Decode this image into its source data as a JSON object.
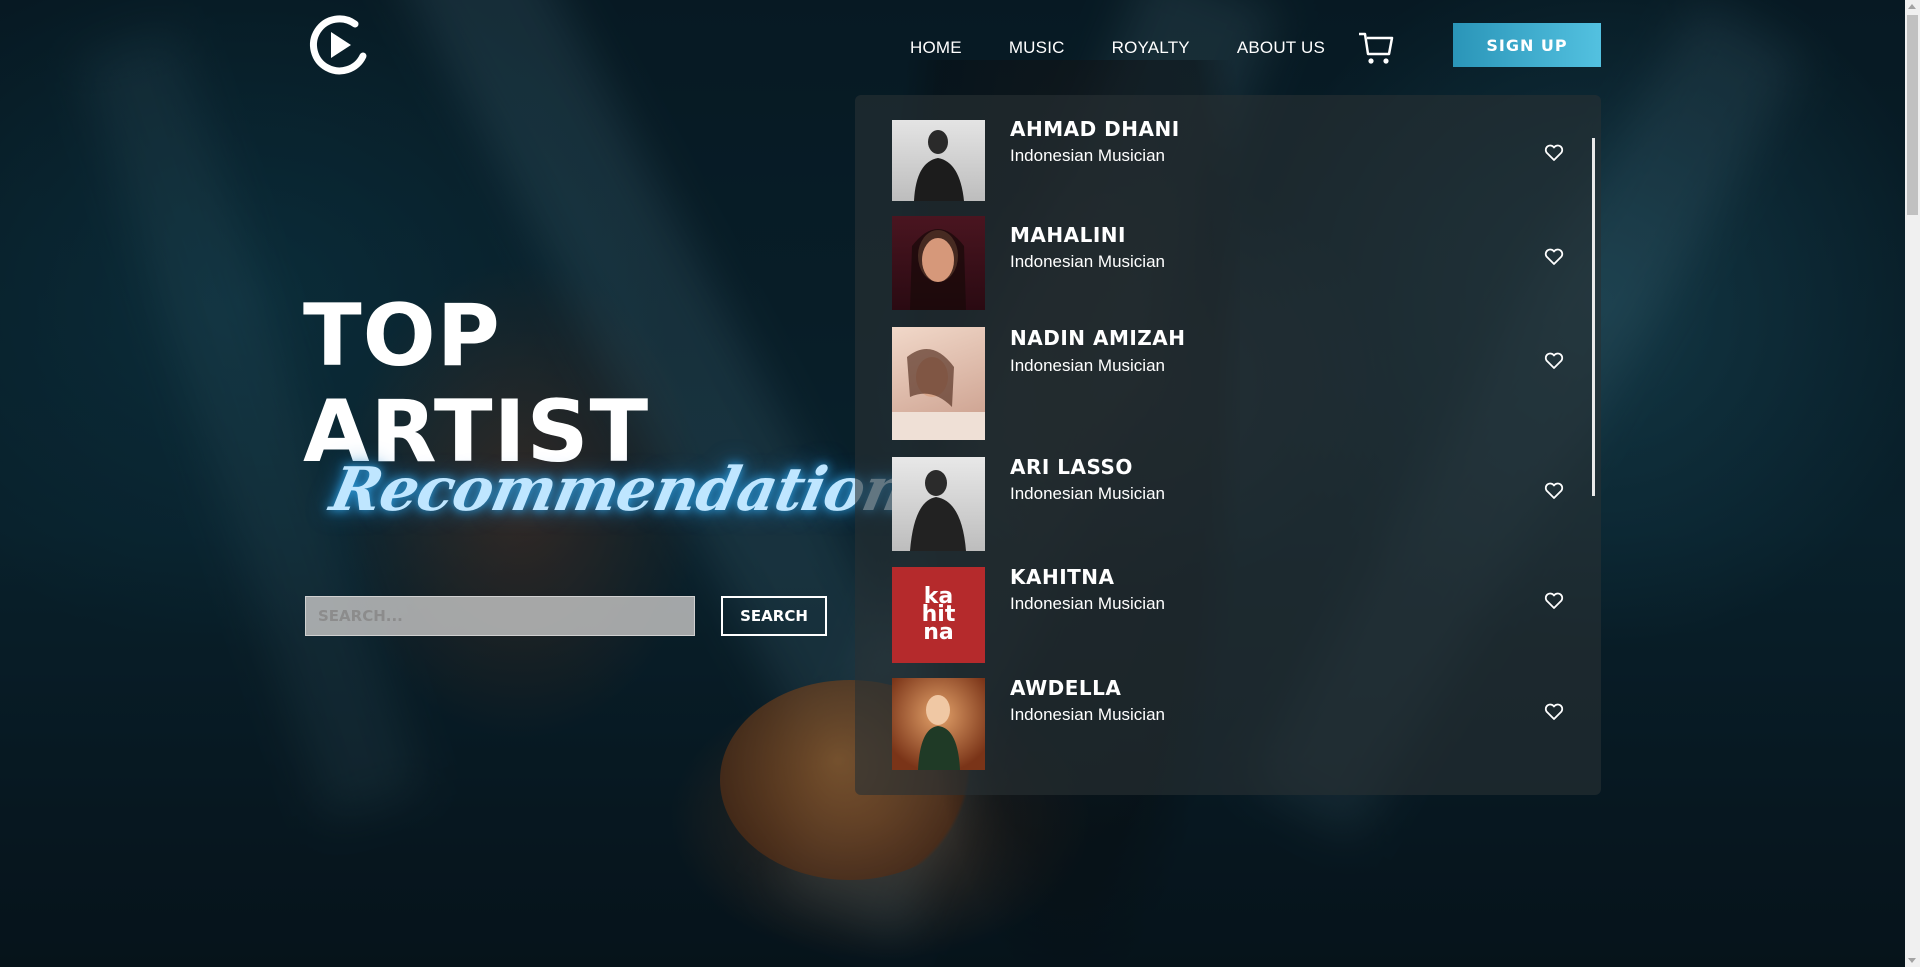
{
  "nav": {
    "items": [
      "HOME",
      "MUSIC",
      "ROYALTY",
      "ABOUT US"
    ],
    "signup_label": "SIGN UP"
  },
  "hero": {
    "line1": "TOP",
    "line2": "ARTIST",
    "script": "Recommendation"
  },
  "search": {
    "placeholder": "SEARCH...",
    "button_label": "SEARCH"
  },
  "artists": [
    {
      "name": "AHMAD DHANI",
      "role": "Indonesian Musician"
    },
    {
      "name": "MAHALINI",
      "role": "Indonesian Musician"
    },
    {
      "name": "NADIN AMIZAH",
      "role": "Indonesian Musician"
    },
    {
      "name": "ARI LASSO",
      "role": "Indonesian Musician"
    },
    {
      "name": "KAHITNA",
      "role": "Indonesian Musician",
      "thumb_text": "ka\nhit\nna"
    },
    {
      "name": "AWDELLA",
      "role": "Indonesian Musician"
    }
  ],
  "colors": {
    "accent": "#3aaed0",
    "panel": "#283034",
    "kahitna_red": "#b52a2c"
  }
}
